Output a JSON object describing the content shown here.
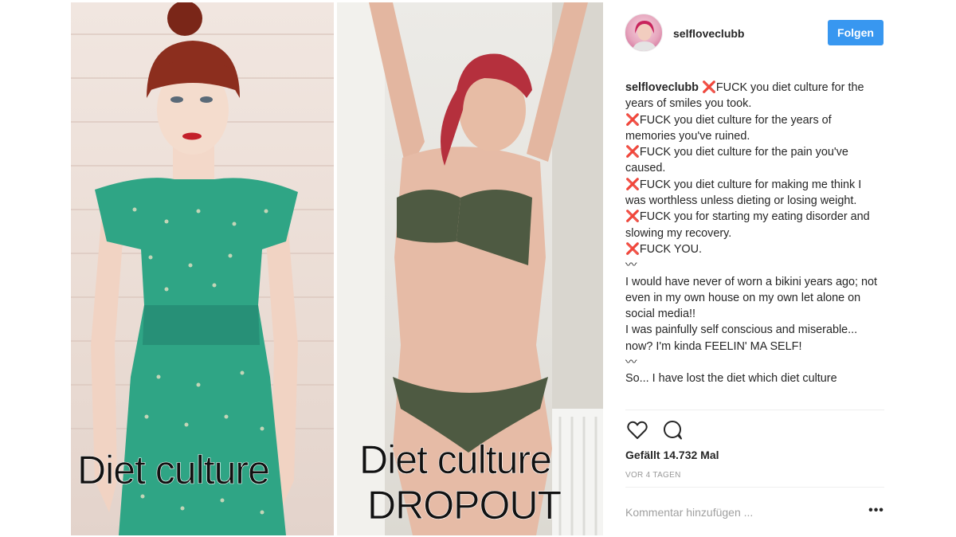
{
  "photos": {
    "left": {
      "caption": "Diet culture"
    },
    "right": {
      "caption_line1": "Diet culture",
      "caption_line2": "DROPOUT"
    }
  },
  "post": {
    "username": "selfloveclubb",
    "follow_label": "Folgen",
    "caption_username": "selfloveclubb",
    "caption_text": " ❌FUCK you diet culture for the years of smiles you took.\n❌FUCK you diet culture for the years of memories you've ruined.\n❌FUCK you diet culture for the pain you've caused.\n❌FUCK you diet culture for making me think I was worthless unless dieting or losing weight.\n❌FUCK you for starting my eating disorder and slowing my recovery.\n❌FUCK YOU.\n〰\nI would have never of worn a bikini years ago; not even in my own house on my own let alone on social media!!\nI was painfully self conscious and miserable... now? I'm kinda FEELIN' MA SELF!\n〰\nSo... I have lost the diet which diet culture",
    "likes": "Gefällt 14.732 Mal",
    "time": "VOR 4 TAGEN",
    "comment_placeholder": "Kommentar hinzufügen ...",
    "more_label": "•••"
  },
  "icons": {
    "like": "heart-icon",
    "comment": "comment-icon"
  },
  "colors": {
    "follow_button": "#3897f0",
    "text": "#262626",
    "muted": "#999999",
    "divider": "#efefef"
  }
}
